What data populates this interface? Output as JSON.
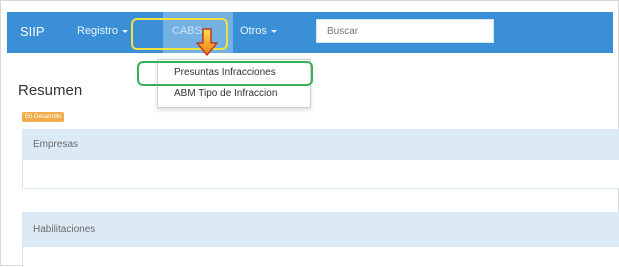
{
  "navbar": {
    "brand": "SIIP",
    "items": [
      {
        "label": "Registro"
      },
      {
        "label": "CABS"
      },
      {
        "label": "Otros"
      }
    ],
    "search_placeholder": "Buscar"
  },
  "dropdown": {
    "items": [
      {
        "label": "Presuntas Infracciones"
      },
      {
        "label": "ABM Tipo de Infraccion"
      }
    ]
  },
  "page": {
    "title": "Resumen",
    "badge": "En Desarrollo"
  },
  "panels": [
    {
      "heading": "Empresas"
    },
    {
      "heading": "Habilitaciones"
    }
  ],
  "colors": {
    "navbar": "#3a8fd6",
    "panel_heading": "#dceaf6",
    "badge": "#f0ad4e",
    "highlight_yellow": "#f0e040",
    "highlight_green": "#35b255",
    "arrow": "#f5a623"
  },
  "icons": {
    "caret": "caret-down-icon",
    "arrow": "arrow-down-icon"
  }
}
